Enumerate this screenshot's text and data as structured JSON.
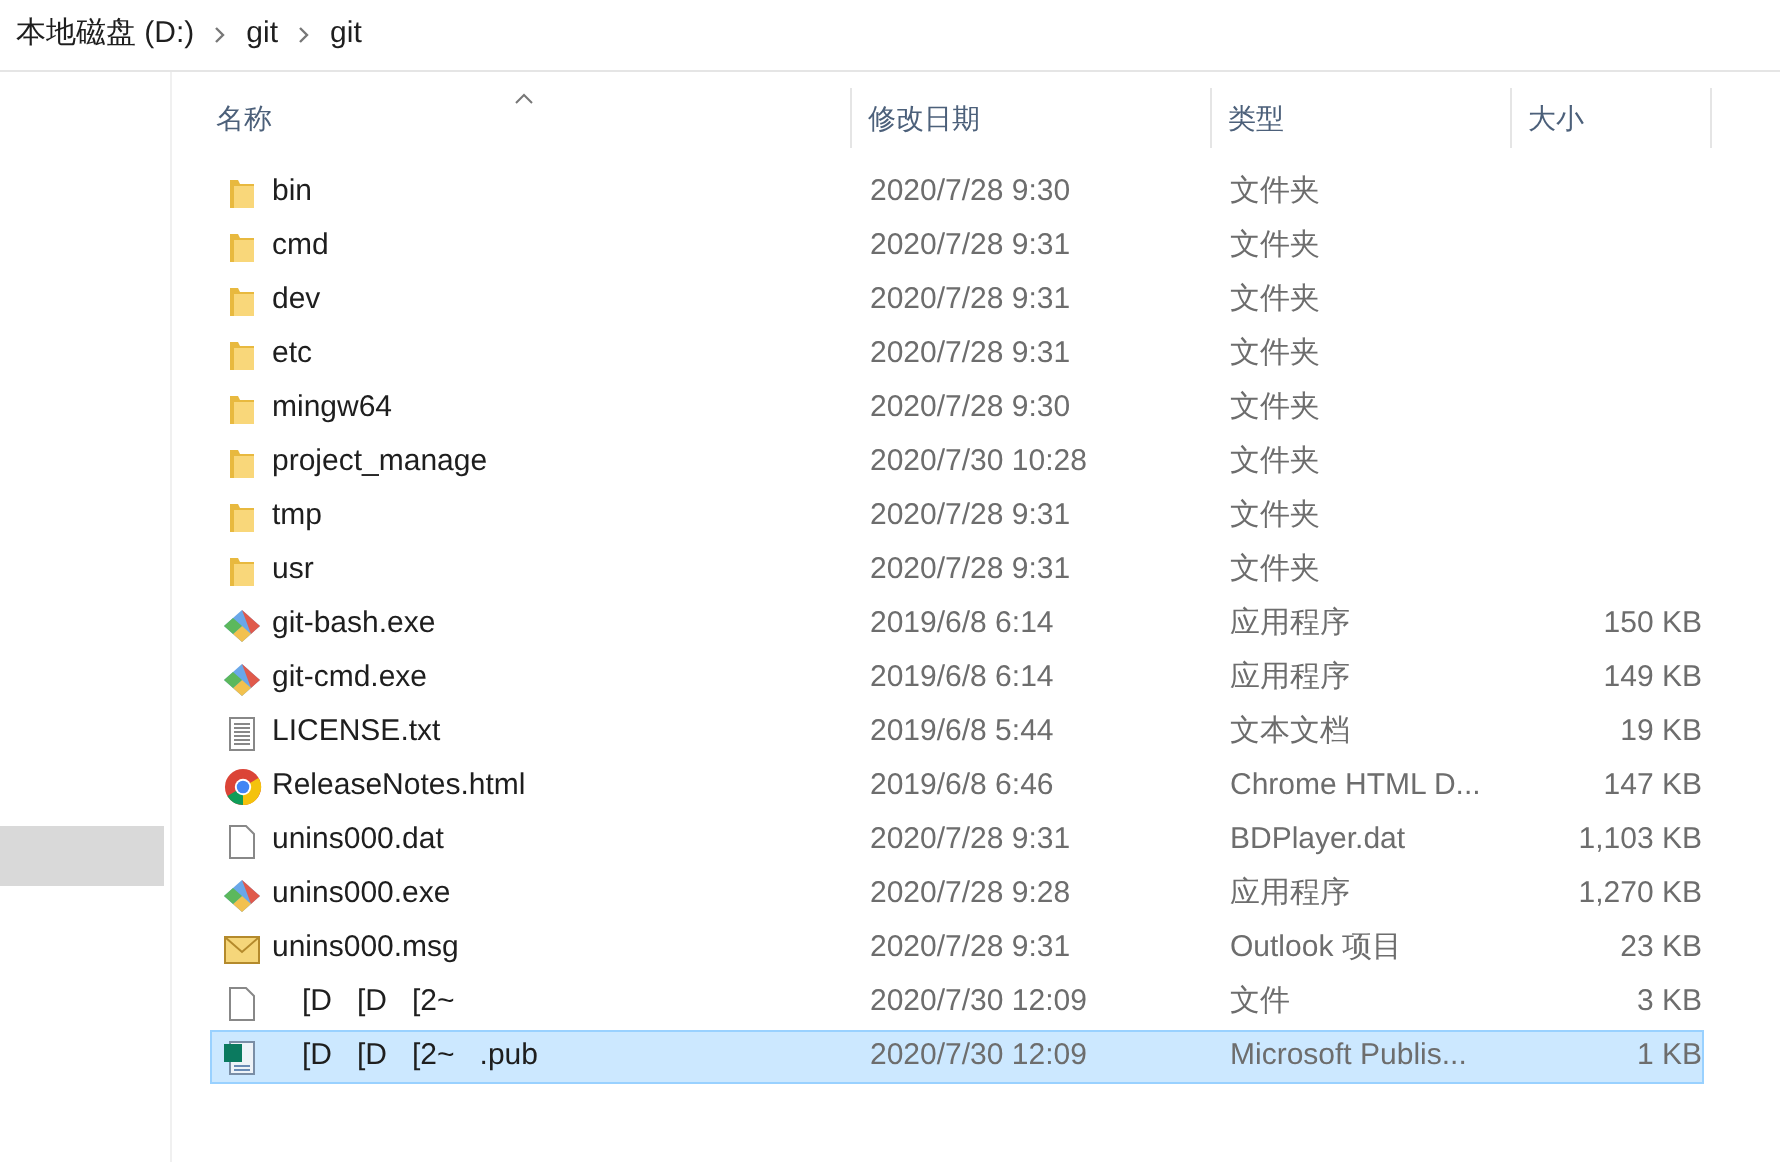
{
  "breadcrumb": [
    "本地磁盘 (D:)",
    "git",
    "git"
  ],
  "sidebar": {
    "highlighted_item": {
      "selected": true
    }
  },
  "columns": [
    {
      "label": "名称",
      "sorted": true
    },
    {
      "label": "修改日期",
      "sorted": false
    },
    {
      "label": "类型",
      "sorted": false
    },
    {
      "label": "大小",
      "sorted": false
    }
  ],
  "rows": [
    {
      "kind": "folder",
      "name": "bin",
      "date": "2020/7/28 9:30",
      "type": "文件夹",
      "selected": false
    },
    {
      "kind": "folder",
      "name": "cmd",
      "date": "2020/7/28 9:31",
      "type": "文件夹",
      "selected": false
    },
    {
      "kind": "folder",
      "name": "dev",
      "date": "2020/7/28 9:31",
      "type": "文件夹",
      "selected": false
    },
    {
      "kind": "folder",
      "name": "etc",
      "date": "2020/7/28 9:31",
      "type": "文件夹",
      "selected": false
    },
    {
      "kind": "folder",
      "name": "mingw64",
      "date": "2020/7/28 9:30",
      "type": "文件夹",
      "selected": false
    },
    {
      "kind": "folder",
      "name": "project_manage",
      "date": "2020/7/30 10:28",
      "type": "文件夹",
      "selected": false
    },
    {
      "kind": "folder",
      "name": "tmp",
      "date": "2020/7/28 9:31",
      "type": "文件夹",
      "selected": false
    },
    {
      "kind": "folder",
      "name": "usr",
      "date": "2020/7/28 9:31",
      "type": "文件夹",
      "selected": false
    },
    {
      "kind": "git",
      "name": "git-bash.exe",
      "date": "2019/6/8 6:14",
      "type": "应用程序",
      "size": "150 KB",
      "selected": false
    },
    {
      "kind": "git",
      "name": "git-cmd.exe",
      "date": "2019/6/8 6:14",
      "type": "应用程序",
      "size": "149 KB",
      "selected": false
    },
    {
      "kind": "text",
      "name": "LICENSE.txt",
      "date": "2019/6/8 5:44",
      "type": "文本文档",
      "size": "19 KB",
      "selected": false
    },
    {
      "kind": "chrome",
      "name": "ReleaseNotes.html",
      "date": "2019/6/8 6:46",
      "type": "Chrome HTML D...",
      "size": "147 KB",
      "selected": false
    },
    {
      "kind": "blank",
      "name": "unins000.dat",
      "date": "2020/7/28 9:31",
      "type": "BDPlayer.dat",
      "size": "1,103 KB",
      "selected": false
    },
    {
      "kind": "git",
      "name": "unins000.exe",
      "date": "2020/7/28 9:28",
      "type": "应用程序",
      "size": "1,270 KB",
      "selected": false
    },
    {
      "kind": "mail",
      "name": "unins000.msg",
      "date": "2020/7/28 9:31",
      "type": "Outlook 项目",
      "size": "23 KB",
      "selected": false
    },
    {
      "kind": "blank",
      "name": "[D   [D   [2~",
      "date": "2020/7/30 12:09",
      "type": "文件",
      "size": "3 KB",
      "selected": false
    },
    {
      "kind": "publisher",
      "name": "[D   [D   [2~   .pub",
      "date": "2020/7/30 12:09",
      "type": "Microsoft Publis...",
      "size": "1 KB",
      "selected": true
    }
  ]
}
